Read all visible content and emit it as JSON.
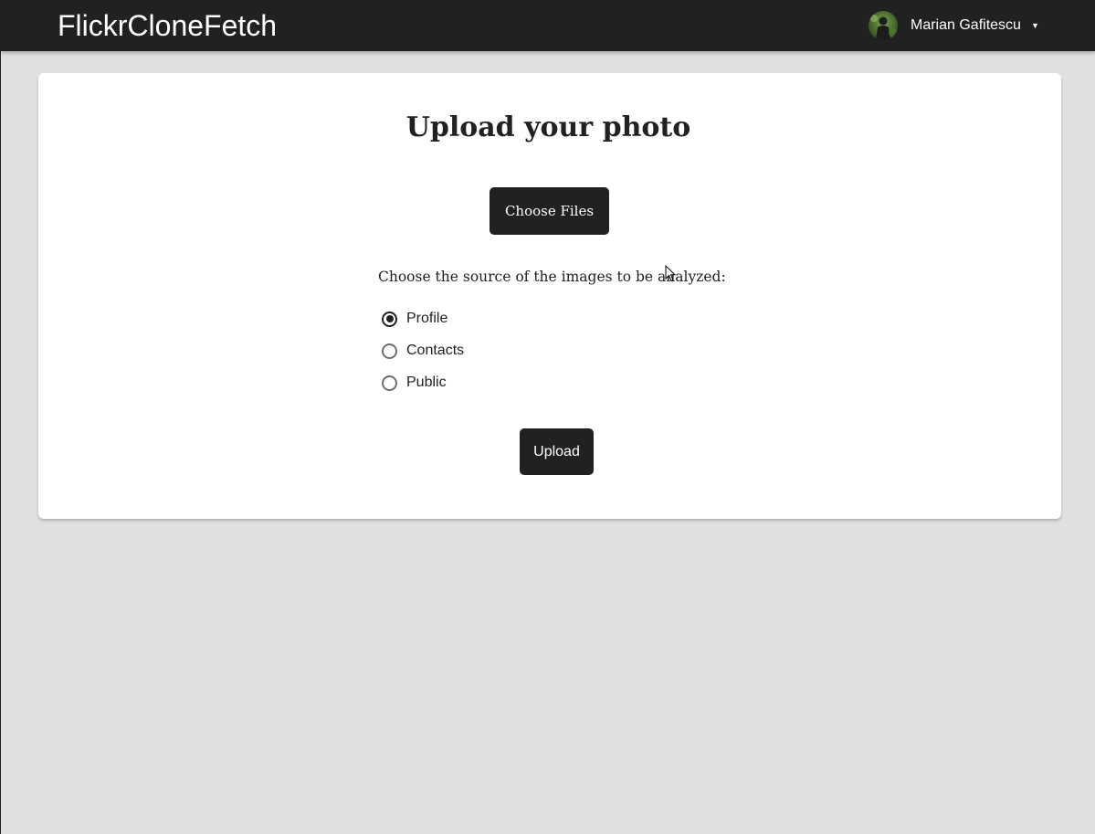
{
  "navbar": {
    "brand": "FlickrCloneFetch",
    "user": {
      "name": "Marian Gafitescu",
      "avatar_icon": "user-avatar",
      "caret": "▼"
    }
  },
  "upload_card": {
    "title": "Upload your photo",
    "choose_files_label": "Choose Files",
    "source_prompt": "Choose the source of the images to be analyzed:",
    "sources": [
      {
        "label": "Profile",
        "checked": true
      },
      {
        "label": "Contacts",
        "checked": false
      },
      {
        "label": "Public",
        "checked": false
      }
    ],
    "upload_label": "Upload"
  },
  "colors": {
    "navbar_bg": "#212121",
    "page_bg": "#e0e0e0",
    "card_bg": "#ffffff",
    "button_bg": "#212121",
    "text": "#212121"
  }
}
